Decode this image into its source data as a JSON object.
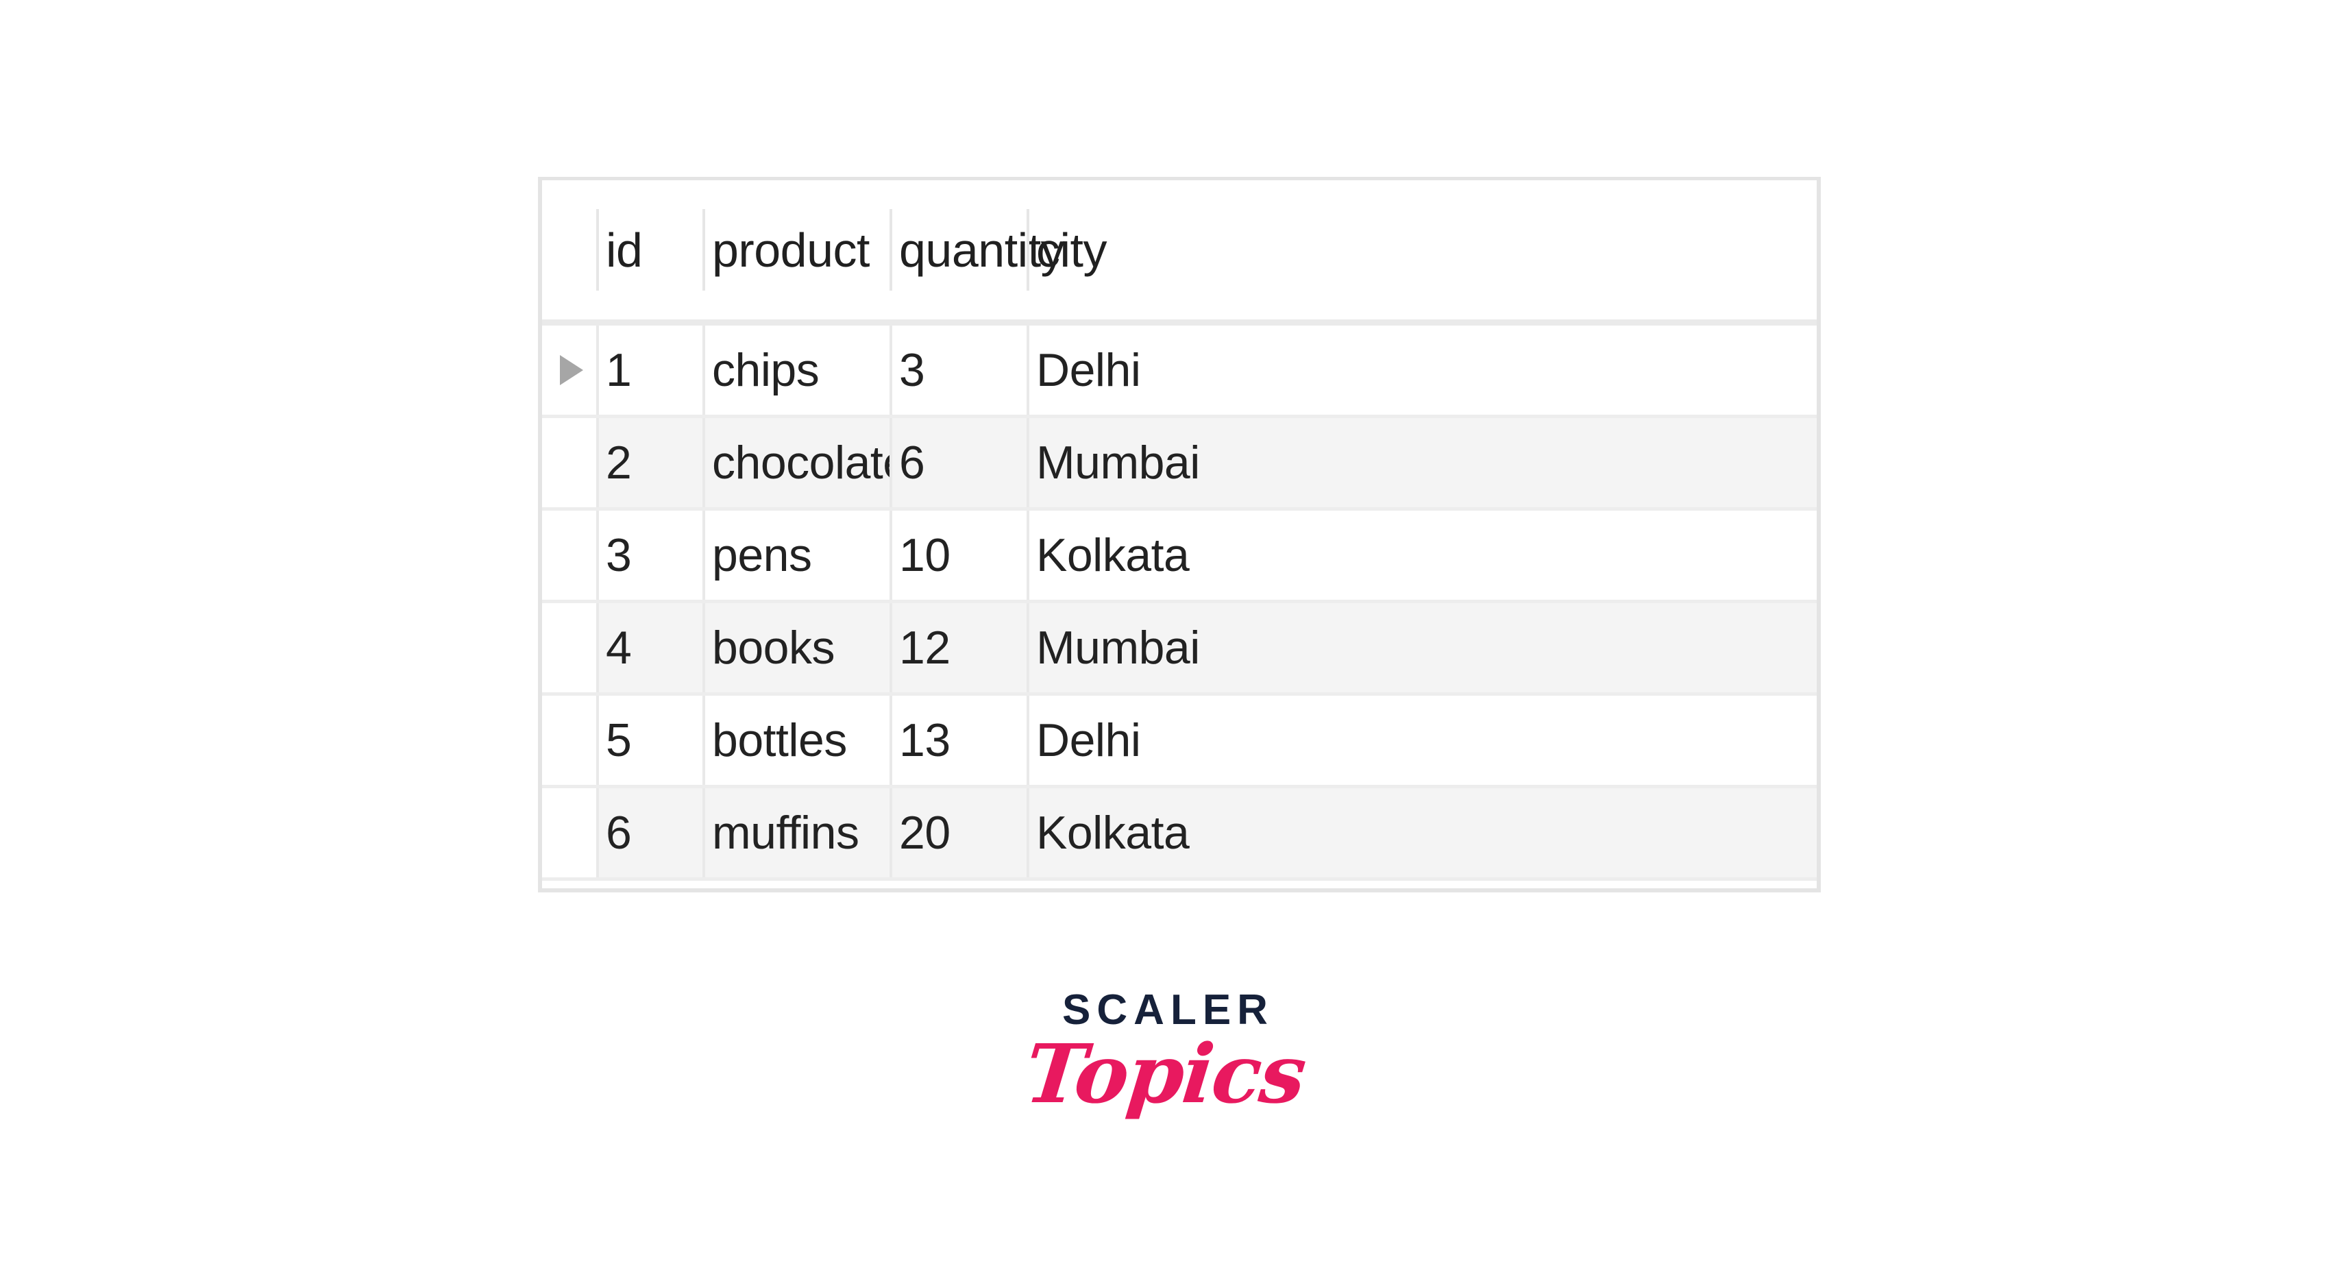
{
  "table": {
    "columns": [
      "id",
      "product",
      "quantity",
      "city"
    ],
    "rows": [
      {
        "marker": "▶",
        "id": "1",
        "product": "chips",
        "quantity": "3",
        "city": "Delhi"
      },
      {
        "marker": "",
        "id": "2",
        "product": "chocolates",
        "quantity": "6",
        "city": "Mumbai"
      },
      {
        "marker": "",
        "id": "3",
        "product": "pens",
        "quantity": "10",
        "city": "Kolkata"
      },
      {
        "marker": "",
        "id": "4",
        "product": "books",
        "quantity": "12",
        "city": "Mumbai"
      },
      {
        "marker": "",
        "id": "5",
        "product": "bottles",
        "quantity": "13",
        "city": "Delhi"
      },
      {
        "marker": "",
        "id": "6",
        "product": "muffins",
        "quantity": "20",
        "city": "Kolkata"
      }
    ],
    "selected_row_index": 0
  },
  "logo": {
    "primary": "SCALER",
    "secondary": "Topics",
    "primary_color": "#16213a",
    "secondary_color": "#e8195f"
  },
  "colors": {
    "canvas": "#ffffff",
    "grid_frame": "#e4e4e4",
    "grid_line": "#ededed",
    "alt_row": "#f4f4f4",
    "text": "#222222",
    "marker": "#a6a6a6"
  }
}
